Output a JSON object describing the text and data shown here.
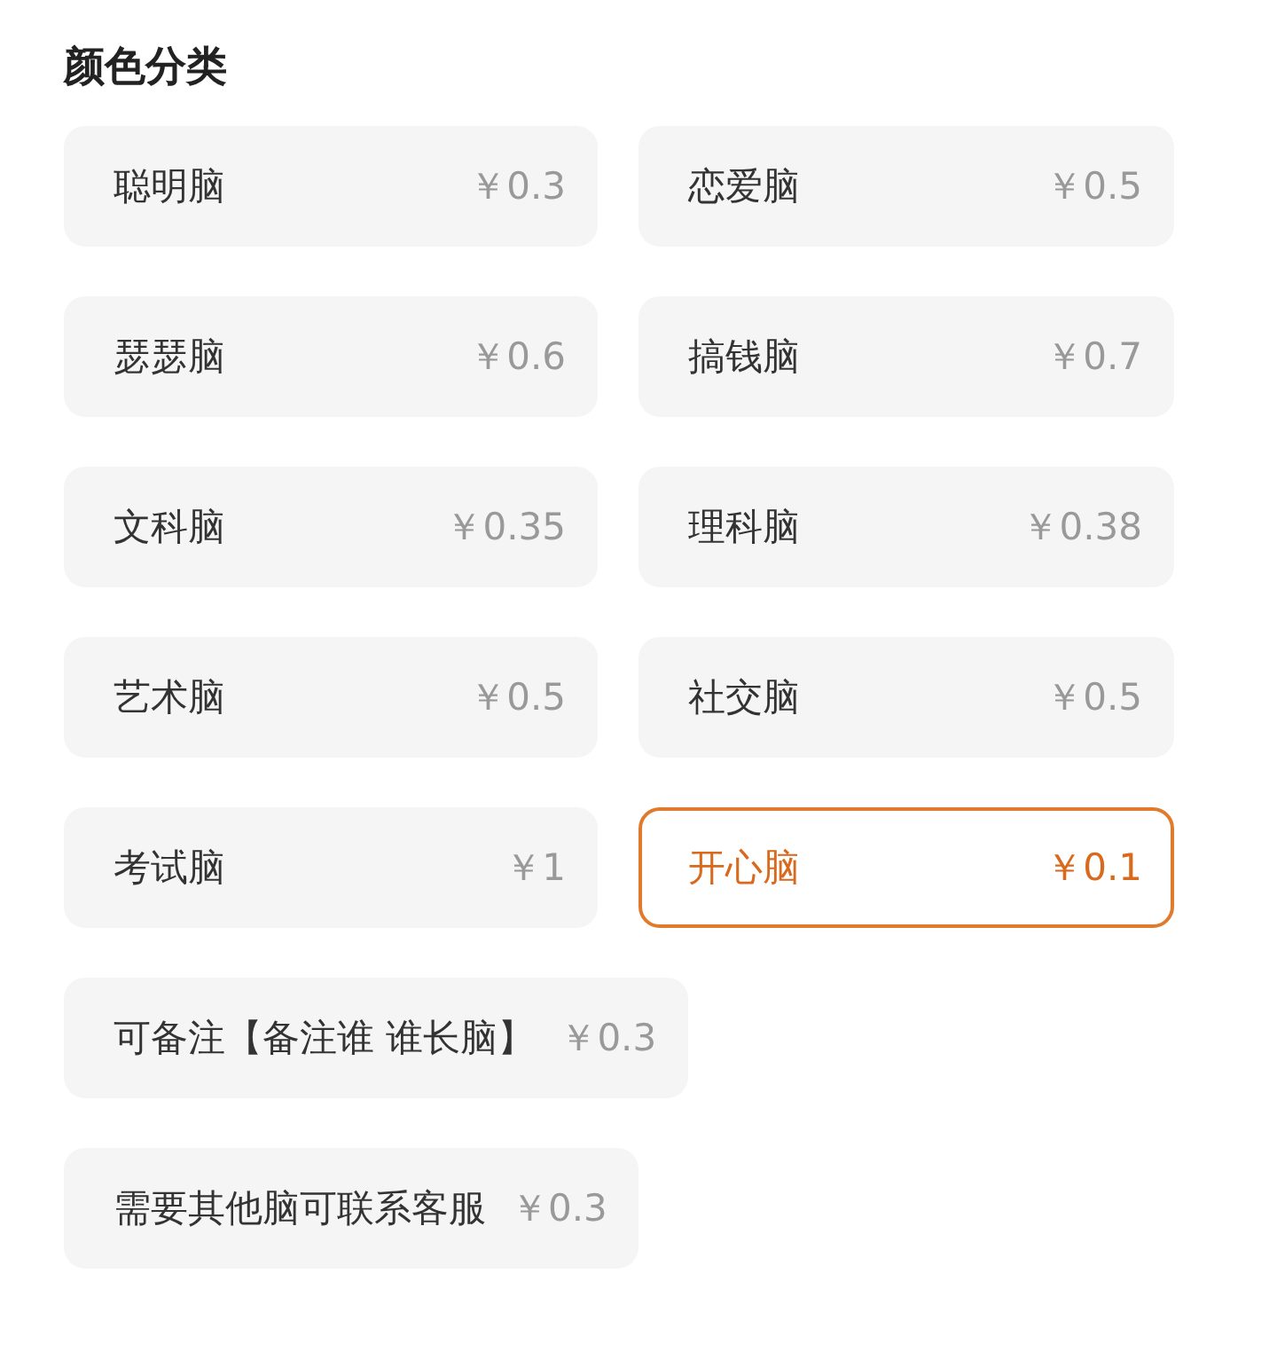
{
  "section_title": "颜色分类",
  "options": [
    {
      "kind": "cell",
      "label": "聪明脑",
      "price": "￥0.3",
      "selected": false
    },
    {
      "kind": "cell",
      "label": "恋爱脑",
      "price": "￥0.5",
      "selected": false
    },
    {
      "kind": "cell",
      "label": "瑟瑟脑",
      "price": "￥0.6",
      "selected": false
    },
    {
      "kind": "cell",
      "label": "搞钱脑",
      "price": "￥0.7",
      "selected": false
    },
    {
      "kind": "cell",
      "label": "文科脑",
      "price": "￥0.35",
      "selected": false
    },
    {
      "kind": "cell",
      "label": "理科脑",
      "price": "￥0.38",
      "selected": false
    },
    {
      "kind": "cell",
      "label": "艺术脑",
      "price": "￥0.5",
      "selected": false
    },
    {
      "kind": "cell",
      "label": "社交脑",
      "price": "￥0.5",
      "selected": false
    },
    {
      "kind": "cell",
      "label": "考试脑",
      "price": "￥1",
      "selected": false
    },
    {
      "kind": "cell",
      "label": "开心脑",
      "price": "￥0.1",
      "selected": true
    },
    {
      "kind": "wide",
      "label": "可备注【备注谁 谁长脑】",
      "price": "￥0.3",
      "selected": false
    },
    {
      "kind": "wide",
      "label": "需要其他脑可联系客服",
      "price": "￥0.3",
      "selected": false
    }
  ]
}
